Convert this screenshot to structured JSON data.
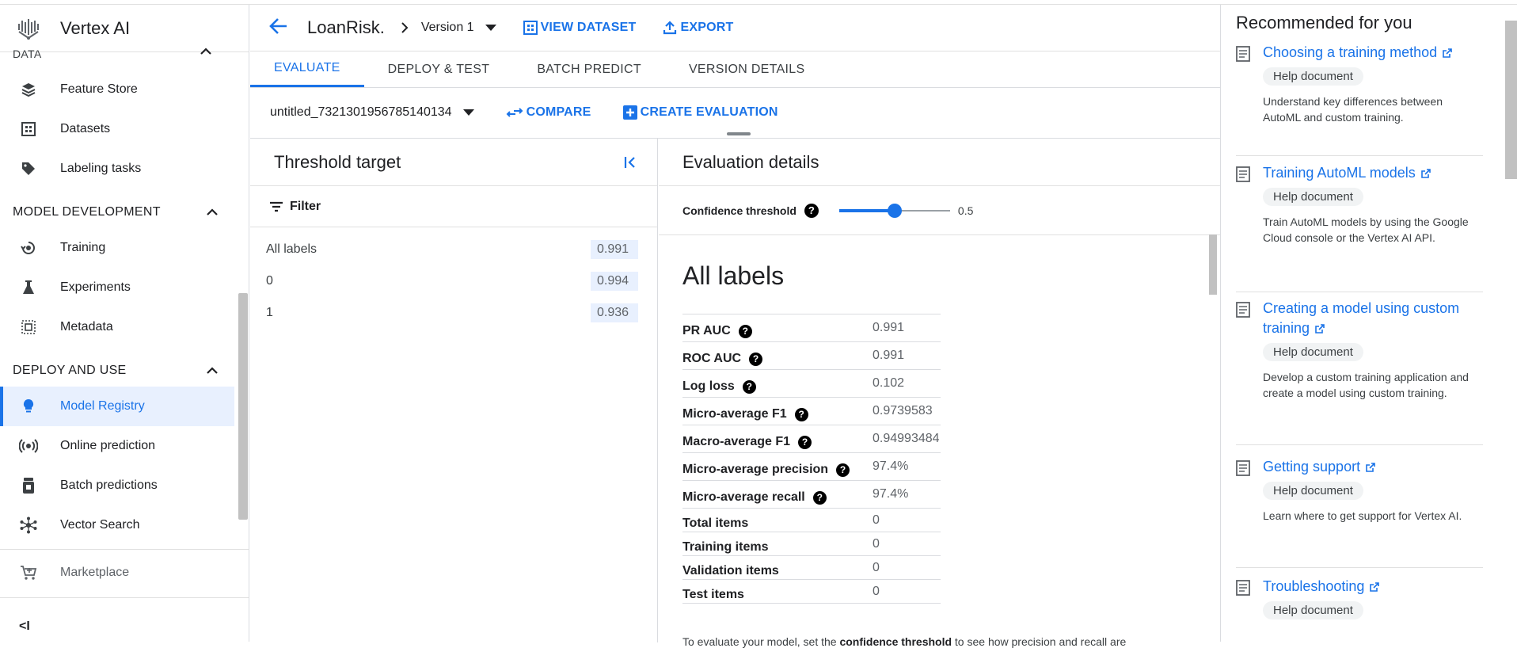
{
  "app": {
    "title": "Vertex AI"
  },
  "sidebar": {
    "cut_section": "DATA",
    "data_items": [
      {
        "label": "Feature Store",
        "icon": "feature-store-icon"
      },
      {
        "label": "Datasets",
        "icon": "datasets-icon"
      },
      {
        "label": "Labeling tasks",
        "icon": "tag-icon"
      }
    ],
    "sections": [
      {
        "label": "MODEL DEVELOPMENT"
      },
      {
        "label": "DEPLOY AND USE"
      }
    ],
    "model_items": [
      {
        "label": "Training",
        "icon": "training-icon"
      },
      {
        "label": "Experiments",
        "icon": "flask-icon"
      },
      {
        "label": "Metadata",
        "icon": "metadata-icon"
      }
    ],
    "deploy_items": [
      {
        "label": "Model Registry",
        "icon": "lightbulb-icon"
      },
      {
        "label": "Online prediction",
        "icon": "broadcast-icon"
      },
      {
        "label": "Batch predictions",
        "icon": "batch-icon"
      },
      {
        "label": "Vector Search",
        "icon": "vector-icon"
      }
    ],
    "marketplace": "Marketplace",
    "collapse": "<I"
  },
  "header": {
    "model_name": "LoanRisk.",
    "version": "Version 1",
    "view_dataset": "VIEW DATASET",
    "export": "EXPORT"
  },
  "tabs": [
    "EVALUATE",
    "DEPLOY & TEST",
    "BATCH PREDICT",
    "VERSION DETAILS"
  ],
  "toolbar": {
    "evaluation": "untitled_7321301956785140134",
    "compare": "COMPARE",
    "create": "CREATE EVALUATION"
  },
  "threshold": {
    "title": "Threshold target",
    "filter": "Filter",
    "rows": [
      {
        "label": "All labels",
        "value": "0.991"
      },
      {
        "label": "0",
        "value": "0.994"
      },
      {
        "label": "1",
        "value": "0.936"
      }
    ]
  },
  "details": {
    "title": "Evaluation details",
    "confidence_label": "Confidence threshold",
    "confidence_value": "0.5",
    "confidence_level": 0.5,
    "labels_title": "All labels",
    "metrics": [
      {
        "name": "PR AUC",
        "value": "0.991",
        "help": true
      },
      {
        "name": "ROC AUC",
        "value": "0.991",
        "help": true
      },
      {
        "name": "Log loss",
        "value": "0.102",
        "help": true
      },
      {
        "name": "Micro-average F1",
        "value": "0.9739583",
        "help": true
      },
      {
        "name": "Macro-average F1",
        "value": "0.94993484",
        "help": true
      },
      {
        "name": "Micro-average precision",
        "value": "97.4%",
        "help": true
      },
      {
        "name": "Micro-average recall",
        "value": "97.4%",
        "help": true
      },
      {
        "name": "Total items",
        "value": "0",
        "help": false
      },
      {
        "name": "Training items",
        "value": "0",
        "help": false
      },
      {
        "name": "Validation items",
        "value": "0",
        "help": false
      },
      {
        "name": "Test items",
        "value": "0",
        "help": false
      }
    ],
    "footer_prefix": "To evaluate your model, set the ",
    "footer_bold": "confidence threshold",
    "footer_suffix": " to see how precision and recall are"
  },
  "recommend": {
    "title": "Recommended for you",
    "chip": "Help document",
    "items": [
      {
        "title": "Choosing a training method",
        "desc": "Understand key differences between AutoML and custom training."
      },
      {
        "title": "Training AutoML models",
        "desc": "Train AutoML models by using the Google Cloud console or the Vertex AI API."
      },
      {
        "title": "Creating a model using custom training",
        "desc": "Develop a custom training application and create a model using custom training."
      },
      {
        "title": "Getting support",
        "desc": "Learn where to get support for Vertex AI."
      },
      {
        "title": "Troubleshooting",
        "desc": ""
      }
    ]
  },
  "colors": {
    "accent": "#1a73e8",
    "active_bg": "#e8f0fe",
    "chip_bg": "#f1f3f4"
  }
}
